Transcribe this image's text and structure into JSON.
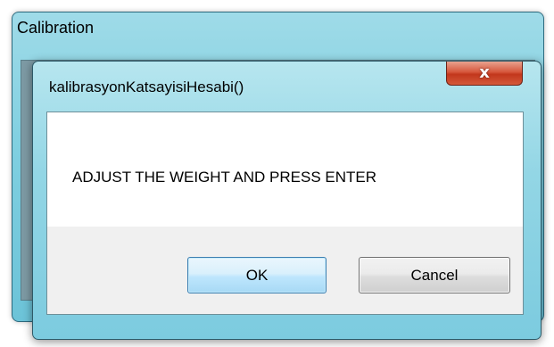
{
  "outer_window": {
    "title": "Calibration"
  },
  "dialog": {
    "title": "kalibrasyonKatsayisiHesabi()",
    "close_glyph": "x",
    "message": "ADJUST THE WEIGHT AND PRESS ENTER",
    "ok_label": "OK",
    "cancel_label": "Cancel"
  },
  "icons": {
    "close": "close-icon"
  },
  "colors": {
    "glass": "#8fd3e3",
    "close_red": "#c2371c",
    "ok_border": "#3c7fb1",
    "client_bg": "#f0f0f0"
  }
}
